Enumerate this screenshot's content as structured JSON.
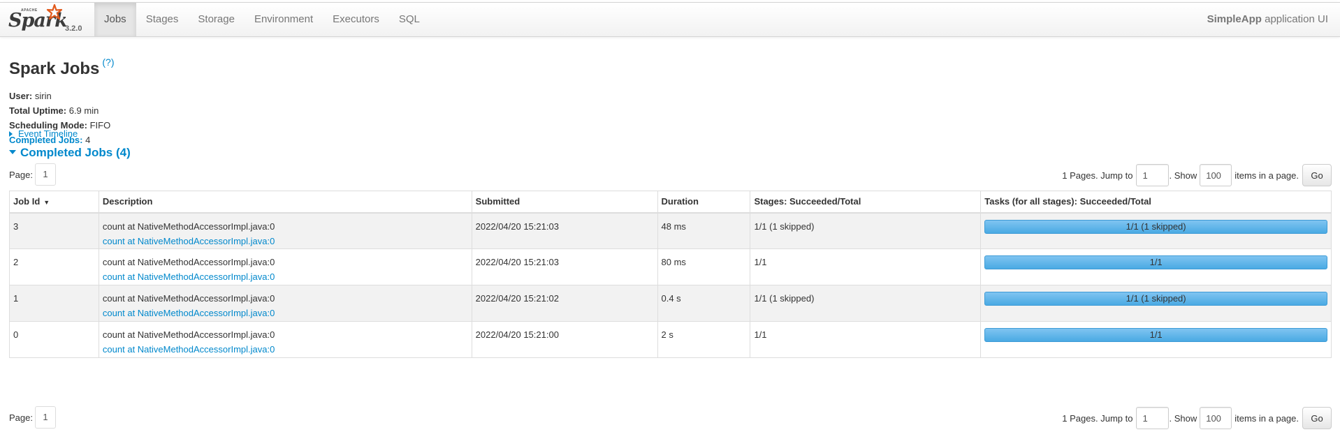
{
  "brand": {
    "apache": "APACHE",
    "name": "Spark",
    "version": "3.2.0"
  },
  "nav": {
    "tabs": [
      {
        "label": "Jobs",
        "active": true
      },
      {
        "label": "Stages",
        "active": false
      },
      {
        "label": "Storage",
        "active": false
      },
      {
        "label": "Environment",
        "active": false
      },
      {
        "label": "Executors",
        "active": false
      },
      {
        "label": "SQL",
        "active": false
      }
    ],
    "app_name": "SimpleApp",
    "app_suffix": "application UI"
  },
  "page": {
    "title": "Spark Jobs",
    "help": "(?)",
    "summary": {
      "user_label": "User:",
      "user": "sirin",
      "uptime_label": "Total Uptime:",
      "uptime": "6.9 min",
      "mode_label": "Scheduling Mode:",
      "mode": "FIFO",
      "completed_label": "Completed Jobs:",
      "completed": "4"
    },
    "event_timeline": "Event Timeline",
    "completed_section": "Completed Jobs (4)"
  },
  "pager": {
    "page_label": "Page:",
    "current_page": "1",
    "pages_text": "1 Pages. Jump to",
    "jump_value": "1",
    "show_text": ". Show",
    "show_value": "100",
    "items_text": "items in a page.",
    "go_label": "Go"
  },
  "table": {
    "headers": [
      "Job Id",
      "Description",
      "Submitted",
      "Duration",
      "Stages: Succeeded/Total",
      "Tasks (for all stages): Succeeded/Total"
    ],
    "sort_indicator": "▼",
    "rows": [
      {
        "id": "3",
        "desc": "count at NativeMethodAccessorImpl.java:0",
        "desc_link": "count at NativeMethodAccessorImpl.java:0",
        "submitted": "2022/04/20 15:21:03",
        "duration": "48 ms",
        "stages": "1/1 (1 skipped)",
        "tasks": "1/1 (1 skipped)",
        "progress": 1.0
      },
      {
        "id": "2",
        "desc": "count at NativeMethodAccessorImpl.java:0",
        "desc_link": "count at NativeMethodAccessorImpl.java:0",
        "submitted": "2022/04/20 15:21:03",
        "duration": "80 ms",
        "stages": "1/1",
        "tasks": "1/1",
        "progress": 1.0
      },
      {
        "id": "1",
        "desc": "count at NativeMethodAccessorImpl.java:0",
        "desc_link": "count at NativeMethodAccessorImpl.java:0",
        "submitted": "2022/04/20 15:21:02",
        "duration": "0.4 s",
        "stages": "1/1 (1 skipped)",
        "tasks": "1/1 (1 skipped)",
        "progress": 1.0
      },
      {
        "id": "0",
        "desc": "count at NativeMethodAccessorImpl.java:0",
        "desc_link": "count at NativeMethodAccessorImpl.java:0",
        "submitted": "2022/04/20 15:21:00",
        "duration": "2 s",
        "stages": "1/1",
        "tasks": "1/1",
        "progress": 1.0
      }
    ]
  },
  "colors": {
    "link": "#0088cc",
    "progress": "#5cb3e8",
    "spark_orange": "#e25a1c"
  }
}
